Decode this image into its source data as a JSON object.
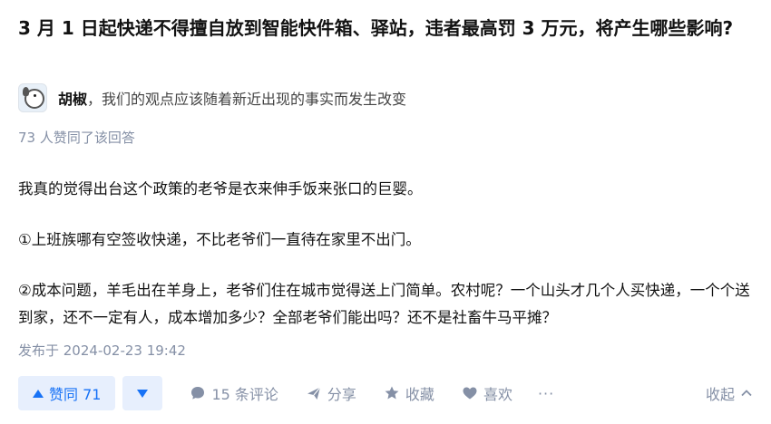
{
  "question": {
    "title": "3 月 1 日起快递不得擅自放到智能快件箱、驿站，违者最高罚 3 万元，将产生哪些影响?"
  },
  "author": {
    "name": "胡椒",
    "bio": "，我们的观点应该随着新近出现的事实而发生改变"
  },
  "answer": {
    "vote_summary": "73 人赞同了该回答",
    "paragraphs": [
      "我真的觉得出台这个政策的老爷是衣来伸手饭来张口的巨婴。",
      "①上班族哪有空签收快递，不比老爷们一直待在家里不出门。",
      "②成本问题，羊毛出在羊身上，老爷们住在城市觉得送上门简单。农村呢？一个山头才几个人买快递，一个个送到家，还不一定有人，成本增加多少？全部老爷们能出吗？还不是社畜牛马平摊？"
    ],
    "published": "发布于 2024-02-23 19:42"
  },
  "actions": {
    "upvote_label": "赞同 71",
    "comments_label": "15 条评论",
    "share_label": "分享",
    "collect_label": "收藏",
    "like_label": "喜欢",
    "more_label": "···",
    "collapse_label": "收起"
  },
  "colors": {
    "accent": "#1772f6",
    "accent_bg": "#e7effd",
    "muted": "#8590a6"
  }
}
